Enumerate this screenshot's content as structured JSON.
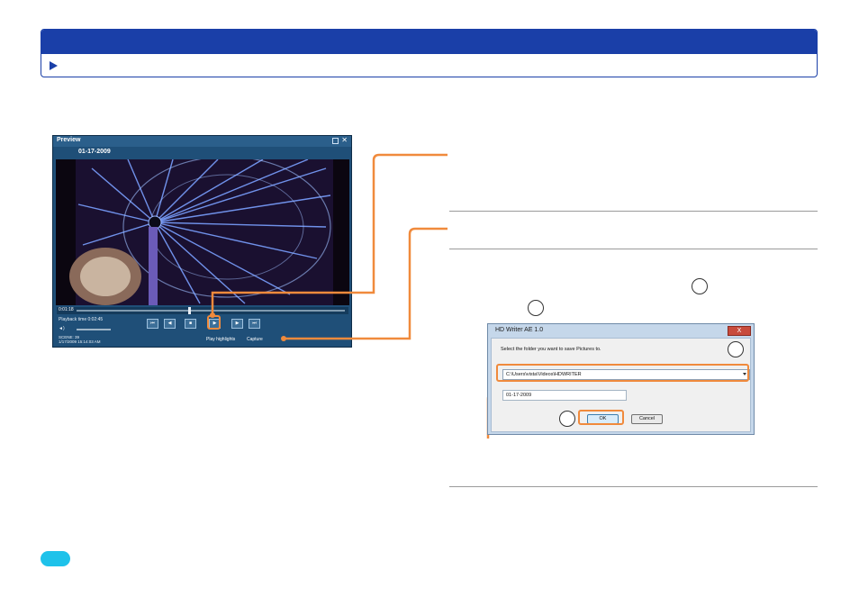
{
  "banner": {
    "title": "",
    "subtitle": ""
  },
  "preview": {
    "title": "Preview",
    "date": "01-17-2009",
    "seek_time": "0:01:18",
    "playback_time": "Playback time   0:02:45",
    "volume_label": "◄)",
    "scene_line1": "SCENE: 39",
    "scene_line2": "1/17/2009 15:14:03 AM",
    "play_highlights": "Play highlights",
    "capture": "Capture"
  },
  "dialog": {
    "title": "HD Writer AE 1.0",
    "close": "X",
    "message": "Select the folder you want to save Pictures to.",
    "folder_path": "C:\\Users\\vista\\Videos\\HDWRITER",
    "file_name": "01-17-2009",
    "ok_label": "OK",
    "cancel_label": "Cancel"
  },
  "colors": {
    "banner_blue": "#1a3fa8",
    "highlight_orange": "#f08a3c",
    "page_pill": "#1ec2ea"
  },
  "icons": [
    "play-arrow-icon",
    "minimize-icon",
    "close-icon",
    "dropdown-arrow-icon"
  ]
}
